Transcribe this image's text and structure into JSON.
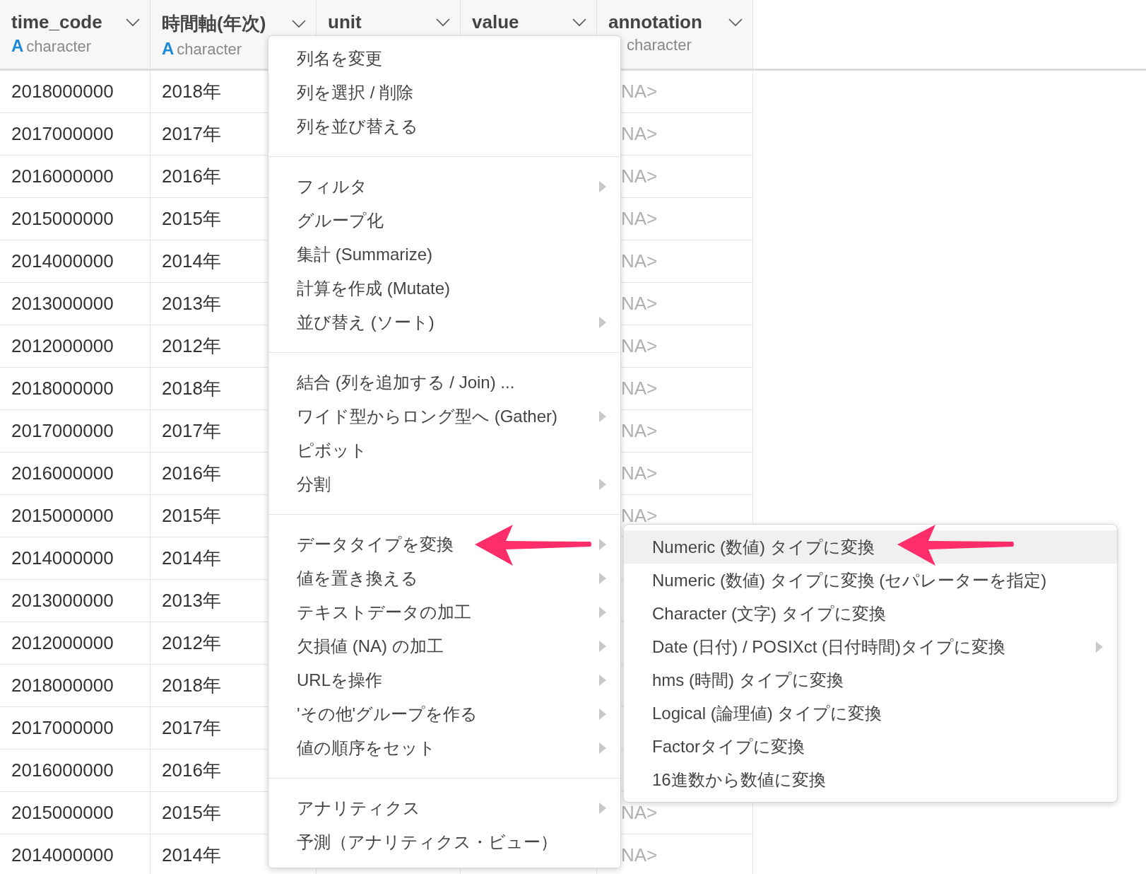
{
  "table": {
    "columns": [
      {
        "name": "time_code",
        "type_icon": "A",
        "type": "character"
      },
      {
        "name": "時間軸(年次)",
        "type_icon": "A",
        "type": "character"
      },
      {
        "name": "unit"
      },
      {
        "name": "value"
      },
      {
        "name": "annotation",
        "type": "character"
      }
    ],
    "rows": [
      {
        "time_code": "2018000000",
        "year": "2018年",
        "annotation": "NA>"
      },
      {
        "time_code": "2017000000",
        "year": "2017年",
        "annotation": "NA>"
      },
      {
        "time_code": "2016000000",
        "year": "2016年",
        "annotation": "NA>"
      },
      {
        "time_code": "2015000000",
        "year": "2015年",
        "annotation": "NA>"
      },
      {
        "time_code": "2014000000",
        "year": "2014年",
        "annotation": "NA>"
      },
      {
        "time_code": "2013000000",
        "year": "2013年",
        "annotation": "NA>"
      },
      {
        "time_code": "2012000000",
        "year": "2012年",
        "annotation": "NA>"
      },
      {
        "time_code": "2018000000",
        "year": "2018年",
        "annotation": "NA>"
      },
      {
        "time_code": "2017000000",
        "year": "2017年",
        "annotation": "NA>"
      },
      {
        "time_code": "2016000000",
        "year": "2016年",
        "annotation": "NA>"
      },
      {
        "time_code": "2015000000",
        "year": "2015年",
        "annotation": "NA>"
      },
      {
        "time_code": "2014000000",
        "year": "2014年"
      },
      {
        "time_code": "2013000000",
        "year": "2013年"
      },
      {
        "time_code": "2012000000",
        "year": "2012年"
      },
      {
        "time_code": "2018000000",
        "year": "2018年"
      },
      {
        "time_code": "2017000000",
        "year": "2017年"
      },
      {
        "time_code": "2016000000",
        "year": "2016年"
      },
      {
        "time_code": "2015000000",
        "year": "2015年",
        "annotation": "NA>"
      },
      {
        "time_code": "2014000000",
        "year": "2014年",
        "annotation": "NA>"
      }
    ]
  },
  "context_menu": {
    "groups": [
      [
        {
          "label": "列名を変更",
          "has_submenu": false
        },
        {
          "label": "列を選択 / 削除",
          "has_submenu": false
        },
        {
          "label": "列を並び替える",
          "has_submenu": false
        }
      ],
      [
        {
          "label": "フィルタ",
          "has_submenu": true
        },
        {
          "label": "グループ化",
          "has_submenu": false
        },
        {
          "label": "集計 (Summarize)",
          "has_submenu": false
        },
        {
          "label": "計算を作成 (Mutate)",
          "has_submenu": false
        },
        {
          "label": "並び替え (ソート)",
          "has_submenu": true
        }
      ],
      [
        {
          "label": "結合 (列を追加する / Join) ...",
          "has_submenu": false
        },
        {
          "label": "ワイド型からロング型へ (Gather)",
          "has_submenu": true
        },
        {
          "label": "ピボット",
          "has_submenu": false
        },
        {
          "label": "分割",
          "has_submenu": true
        }
      ],
      [
        {
          "label": "データタイプを変換",
          "has_submenu": true
        },
        {
          "label": "値を置き換える",
          "has_submenu": true
        },
        {
          "label": "テキストデータの加工",
          "has_submenu": true
        },
        {
          "label": "欠損値 (NA) の加工",
          "has_submenu": true
        },
        {
          "label": "URLを操作",
          "has_submenu": true
        },
        {
          "label": "'その他'グループを作る",
          "has_submenu": true
        },
        {
          "label": "値の順序をセット",
          "has_submenu": true
        }
      ],
      [
        {
          "label": "アナリティクス",
          "has_submenu": true
        },
        {
          "label": "予測（アナリティクス・ビュー）",
          "has_submenu": false
        }
      ]
    ]
  },
  "submenu": {
    "items": [
      {
        "label": "Numeric (数値) タイプに変換",
        "selected": true,
        "has_submenu": false
      },
      {
        "label": "Numeric (数値) タイプに変換 (セパレーターを指定)",
        "selected": false,
        "has_submenu": false
      },
      {
        "label": "Character (文字) タイプに変換",
        "selected": false,
        "has_submenu": false
      },
      {
        "label": "Date (日付) / POSIXct (日付時間)タイプに変換",
        "selected": false,
        "has_submenu": true
      },
      {
        "label": "hms (時間) タイプに変換",
        "selected": false,
        "has_submenu": false
      },
      {
        "label": "Logical (論理値) タイプに変換",
        "selected": false,
        "has_submenu": false
      },
      {
        "label": "Factorタイプに変換",
        "selected": false,
        "has_submenu": false
      },
      {
        "label": "16進数から数値に変換",
        "selected": false,
        "has_submenu": false
      }
    ]
  }
}
